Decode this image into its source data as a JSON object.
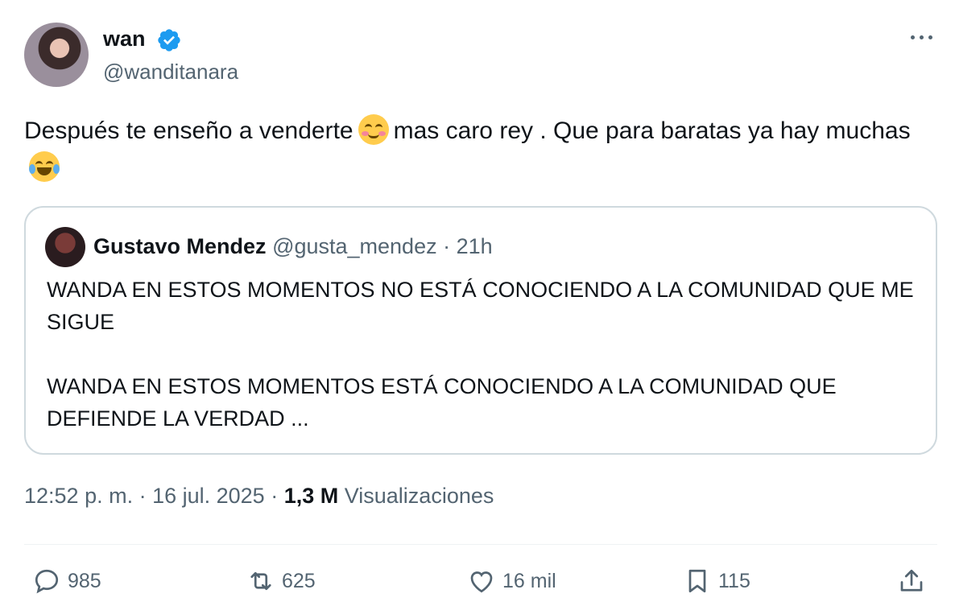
{
  "author": {
    "name": "wan",
    "handle": "@wanditanara"
  },
  "tweet": {
    "text_part1": "Después te enseño a venderte",
    "text_part2": "mas caro rey .  Que para baratas ya hay muchas"
  },
  "quote": {
    "name": "Gustavo Mendez",
    "handle": "@gusta_mendez",
    "time": "· 21h",
    "paragraph1": "WANDA EN ESTOS MOMENTOS NO ESTÁ CONOCIENDO A LA COMUNIDAD QUE ME SIGUE",
    "paragraph2": "WANDA EN ESTOS MOMENTOS ESTÁ CONOCIENDO A LA COMUNIDAD QUE DEFIENDE LA VERDAD ..."
  },
  "meta": {
    "time": "12:52 p. m. · 16 jul. 2025 ·",
    "views": "1,3 M",
    "views_label": "Visualizaciones"
  },
  "actions": {
    "replies": "985",
    "reposts": "625",
    "likes": "16 mil",
    "bookmarks": "115"
  },
  "icons": [
    "verified-badge-icon",
    "more-icon",
    "reply-icon",
    "repost-icon",
    "like-icon",
    "bookmark-icon",
    "share-icon"
  ],
  "colors": {
    "text": "#0f1419",
    "secondary": "#536471",
    "verified": "#1d9bf0",
    "border": "#cfd9de"
  }
}
